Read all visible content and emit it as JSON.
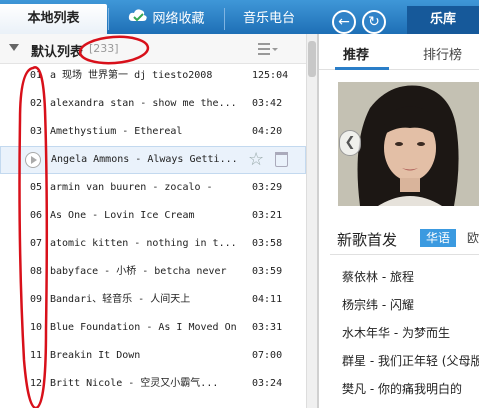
{
  "top_tabs": {
    "local": "本地列表",
    "cloud": "网络收藏",
    "radio": "音乐电台",
    "store": "乐库"
  },
  "playlist": {
    "title": "默认列表",
    "count": "[233]"
  },
  "songs": [
    {
      "idx": "01",
      "title": "a 现场 世界第一 dj tiesto2008",
      "dur": "125:04"
    },
    {
      "idx": "02",
      "title": "alexandra stan - show me the...",
      "dur": "03:42"
    },
    {
      "idx": "03",
      "title": "Amethystium - Ethereal",
      "dur": "04:20"
    },
    {
      "idx": "04",
      "title": "Angela Ammons - Always Getti...",
      "dur": ""
    },
    {
      "idx": "05",
      "title": "armin van buuren - zocalo -",
      "dur": "03:29"
    },
    {
      "idx": "06",
      "title": "As One - Lovin Ice Cream",
      "dur": "03:21"
    },
    {
      "idx": "07",
      "title": "atomic kitten - nothing in t...",
      "dur": "03:58"
    },
    {
      "idx": "08",
      "title": "babyface - 小桥 - betcha never",
      "dur": "03:59"
    },
    {
      "idx": "09",
      "title": "Bandari、轻音乐 - 人间天上",
      "dur": "04:11"
    },
    {
      "idx": "10",
      "title": "Blue Foundation - As I Moved On",
      "dur": "03:31"
    },
    {
      "idx": "11",
      "title": "Breakin It Down",
      "dur": "07:00"
    },
    {
      "idx": "12",
      "title": "Britt Nicole - 空灵又小霸气...",
      "dur": "03:24"
    }
  ],
  "store": {
    "tab_recommend": "推荐",
    "tab_rank": "排行榜",
    "new_songs_heading": "新歌首发",
    "lang_chinese": "华语",
    "lang_europe": "欧",
    "new_songs": [
      "蔡依林 - 旅程",
      "杨宗纬 - 闪耀",
      "水木年华 - 为梦而生",
      "群星 - 我们正年轻 (父母版)",
      "樊凡 - 你的痛我明白的"
    ]
  },
  "colors": {
    "topbar": "#1e6fb6",
    "accent": "#3b9ae0",
    "annotation": "#d8101a"
  }
}
